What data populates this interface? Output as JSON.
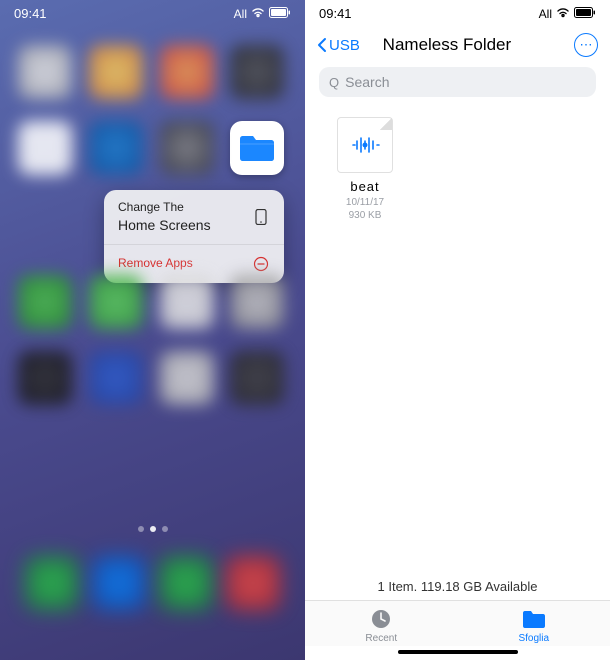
{
  "left": {
    "status": {
      "time": "09:41",
      "carrier": "All"
    },
    "menu": {
      "line1": "Change The",
      "line2": "Home Screens",
      "remove": "Remove Apps"
    }
  },
  "right": {
    "status": {
      "time": "09:41",
      "carrier": "All"
    },
    "nav": {
      "back": "USB",
      "title": "Nameless Folder"
    },
    "search": {
      "placeholder": "Search"
    },
    "file": {
      "name": "beat",
      "date": "10/11/17",
      "size": "930 KB"
    },
    "footer": "1 Item. 119.18 GB Available",
    "tabs": {
      "recent": "Recent",
      "browse": "Sfoglia"
    }
  }
}
